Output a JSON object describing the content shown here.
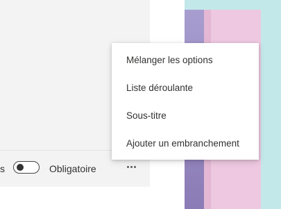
{
  "question_footer": {
    "prev_label_fragment": "s",
    "required_label": "Obligatoire",
    "required_on": false,
    "more_icon": "ellipsis-icon"
  },
  "menu": {
    "items": [
      {
        "label": "Mélanger les options"
      },
      {
        "label": "Liste déroulante"
      },
      {
        "label": "Sous-titre"
      },
      {
        "label": "Ajouter un embranchement"
      }
    ]
  },
  "colors": {
    "card_bg": "#f3f3f3",
    "text": "#323130",
    "art_teal": "#c3e8ea",
    "art_purple": "#8b7bb6",
    "art_pink": "#eec8e0"
  }
}
